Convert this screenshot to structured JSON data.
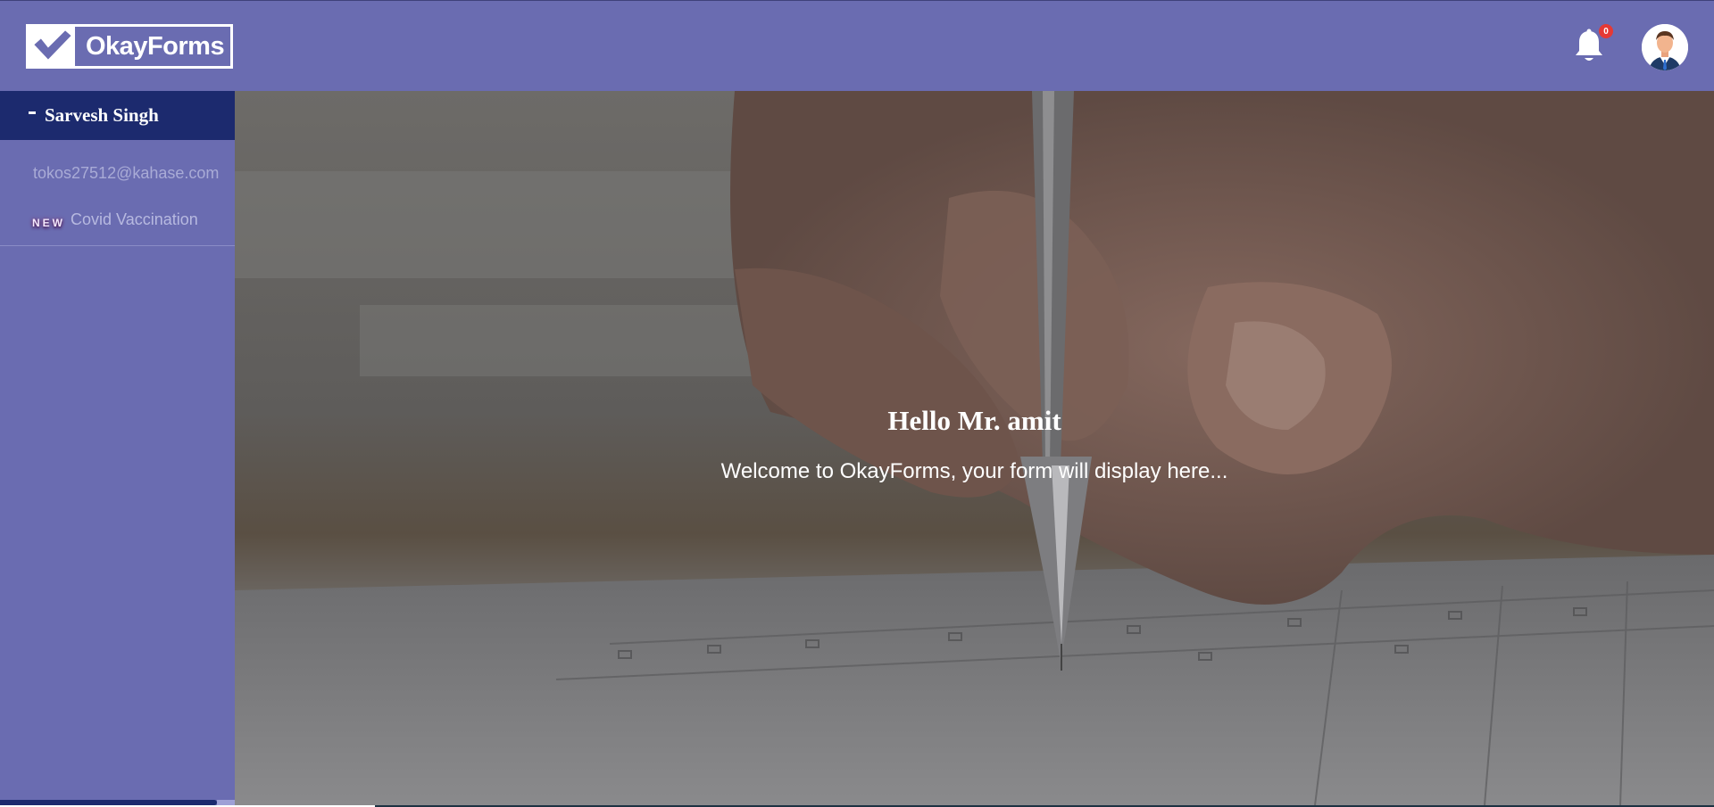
{
  "header": {
    "logo_text": "OkayForms",
    "notification_count": "0",
    "bell_icon": "bell-icon",
    "avatar_icon": "user-avatar-icon"
  },
  "sidebar": {
    "user_name": "Sarvesh Singh",
    "email": "tokos27512@kahase.com",
    "new_badge": "NEW",
    "menu_item": "Covid Vaccination"
  },
  "main": {
    "greeting": "Hello Mr. amit",
    "welcome": "Welcome to OkayForms, your form will display here..."
  },
  "colors": {
    "header_bg": "#6a6cb1",
    "sidebar_head_bg": "#1c2a6e",
    "badge_red": "#e53935"
  }
}
